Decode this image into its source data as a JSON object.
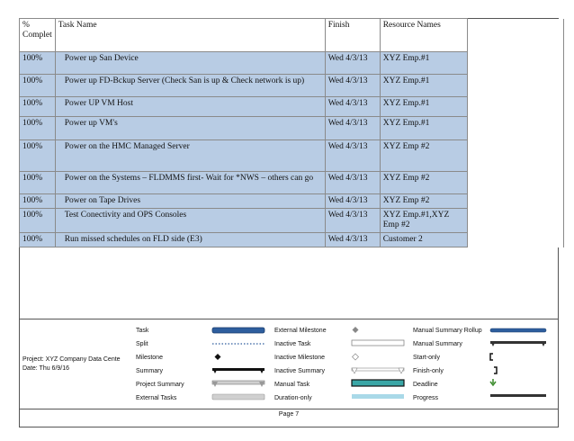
{
  "table": {
    "headers": [
      "% Complet",
      "Task Name",
      "Finish",
      "Resource Names"
    ],
    "rows": [
      {
        "pct": "100%",
        "name": "Power up San Device",
        "finish": "Wed 4/3/13",
        "resources": "XYZ Emp.#1"
      },
      {
        "pct": "100%",
        "name": "Power up FD-Bckup Server (Check San is up & Check network is up)",
        "finish": "Wed 4/3/13",
        "resources": "XYZ Emp.#1"
      },
      {
        "pct": "100%",
        "name": "Power UP VM Host",
        "finish": "Wed 4/3/13",
        "resources": "XYZ Emp.#1"
      },
      {
        "pct": "100%",
        "name": "Power up VM's",
        "finish": "Wed 4/3/13",
        "resources": "XYZ Emp.#1"
      },
      {
        "pct": "100%",
        "name": "Power on the HMC Managed Server",
        "finish": "Wed 4/3/13",
        "resources": "XYZ Emp #2"
      },
      {
        "pct": "100%",
        "name": "Power on the Systems – FLDMMS first- Wait for *NWS – others can go",
        "finish": "Wed 4/3/13",
        "resources": "XYZ Emp #2"
      },
      {
        "pct": "100%",
        "name": "Power on Tape Drives",
        "finish": "Wed 4/3/13",
        "resources": "XYZ Emp #2"
      },
      {
        "pct": "100%",
        "name": "Test Conectivity and OPS Consoles",
        "finish": "Wed 4/3/13",
        "resources": "XYZ Emp.#1,XYZ Emp #2"
      },
      {
        "pct": "100%",
        "name": "Run missed schedules on FLD side (E3)",
        "finish": "Wed 4/3/13",
        "resources": "Customer 2"
      }
    ]
  },
  "legend": {
    "project_line": "Project: XYZ Company Data Cente",
    "date_line": "Date: Thu 6/9/16",
    "col1": [
      "Task",
      "Split",
      "Milestone",
      "Summary",
      "Project Summary",
      "External Tasks"
    ],
    "col2": [
      "External Milestone",
      "Inactive Task",
      "Inactive Milestone",
      "Inactive Summary",
      "Manual Task",
      "Duration-only"
    ],
    "col3": [
      "Manual Summary Rollup",
      "Manual Summary",
      "Start-only",
      "Finish-only",
      "Deadline",
      "Progress"
    ],
    "colors": {
      "task_bar": "#2e5e9e",
      "row_fill": "#b8cce4",
      "manual_task": "#3aa6a6",
      "duration_only": "#a9d9e8",
      "deadline": "#3a8a2a"
    }
  },
  "footer": {
    "page": "Page 7"
  }
}
